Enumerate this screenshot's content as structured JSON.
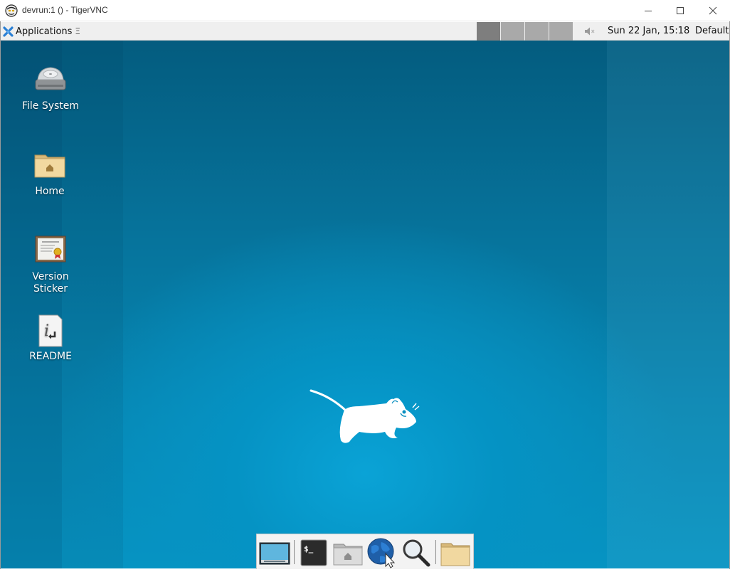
{
  "window": {
    "title": "devrun:1 () - TigerVNC",
    "controls": [
      "minimize-icon",
      "maximize-icon",
      "close-icon"
    ]
  },
  "panel": {
    "applications_label": "Applications",
    "applications_sep": "Ξ",
    "workspaces_count": 4,
    "active_workspace": 1,
    "clock": "Sun 22 Jan, 15:18",
    "user": "Default"
  },
  "desktop": {
    "icons": [
      {
        "label": "File System",
        "icon": "harddrive-icon"
      },
      {
        "label": "Home",
        "icon": "home-folder-icon"
      },
      {
        "label": "Version Sticker",
        "icon": "certificate-icon"
      },
      {
        "label": "README",
        "icon": "info-document-icon"
      }
    ],
    "background_colors": {
      "top": "#045c7f",
      "center": "#0aa3d6"
    }
  },
  "dock": {
    "items": [
      "show-desktop-icon",
      "terminal-icon",
      "home-folder-icon",
      "web-browser-icon",
      "search-icon",
      "folder-icon"
    ]
  }
}
